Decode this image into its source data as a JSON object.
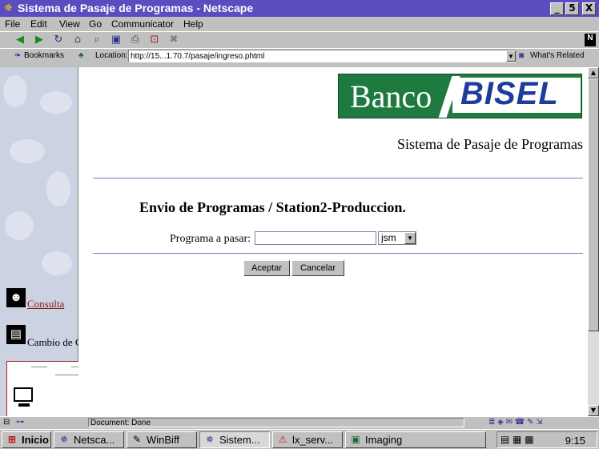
{
  "window": {
    "title": "Sistema de Pasaje de Programas - Netscape",
    "controls": {
      "minimize": "_",
      "maximize": "5",
      "close": "X"
    }
  },
  "menu": {
    "items": [
      "File",
      "Edit",
      "View",
      "Go",
      "Communicator",
      "Help"
    ]
  },
  "toolbar": {
    "icons": [
      "back-icon",
      "forward-icon",
      "reload-icon",
      "home-icon",
      "search-icon",
      "guide-icon",
      "print-icon",
      "security-icon",
      "stop-icon"
    ],
    "throbber": "N"
  },
  "location": {
    "bookmarks_label": "Bookmarks",
    "location_label": "Location:",
    "url": "http://15...1.70.7/pasaje/ingreso.phtml",
    "whats_related": "What's Related"
  },
  "page": {
    "logo_text_1": "Banco",
    "logo_text_2": "BISEL",
    "system_title": "Sistema de Pasaje de Programas",
    "heading": "Envio de Programas / Station2-Produccion.",
    "program_label": "Programa a pasar:",
    "program_value": "",
    "select_value": "jsm",
    "accept_label": "Aceptar",
    "cancel_label": "Cancelar"
  },
  "left_nav": {
    "items": [
      {
        "label": "Consulta"
      },
      {
        "label": "Cambio de Clave"
      }
    ]
  },
  "status": {
    "text": "Document: Done"
  },
  "taskbar": {
    "start_label": "Inicio",
    "tasks": [
      {
        "label": "Netsca..."
      },
      {
        "label": "WinBiff"
      },
      {
        "label": "Sistem..."
      },
      {
        "label": "lx_serv..."
      },
      {
        "label": "Imaging"
      }
    ],
    "clock": "9:15"
  },
  "colors": {
    "titlebar": "#5a4dbf",
    "logo_green": "#1e7a3e",
    "logo_blue": "#1f3c9c"
  }
}
